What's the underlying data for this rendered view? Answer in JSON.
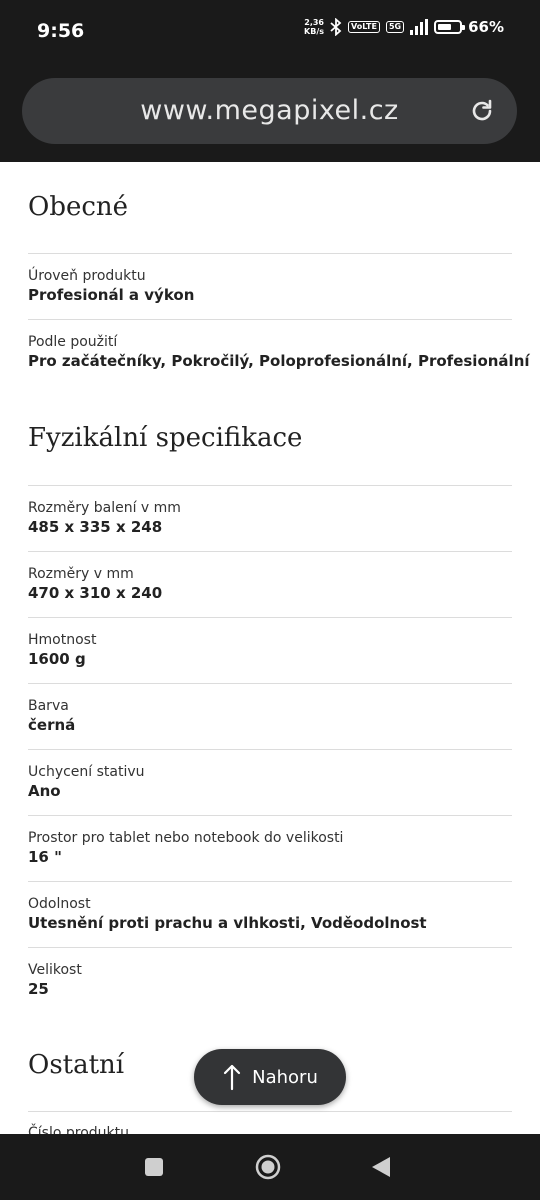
{
  "status": {
    "time": "9:56",
    "netspeed_value": "2,36",
    "netspeed_unit": "KB/s",
    "volte": "VoLTE",
    "network": "5G",
    "battery": "66%",
    "battery_level": 0.66
  },
  "browser": {
    "url": "www.megapixel.cz"
  },
  "sections": [
    {
      "title": "Obecné",
      "rows": [
        {
          "label": "Úroveň produktu",
          "value": "Profesionál a výkon"
        },
        {
          "label": "Podle použití",
          "value": "Pro začátečníky, Pokročilý, Poloprofesionální, Profesionální"
        }
      ]
    },
    {
      "title": "Fyzikální specifikace",
      "rows": [
        {
          "label": "Rozměry balení v mm",
          "value": "485 x 335 x 248"
        },
        {
          "label": "Rozměry v mm",
          "value": "470 x 310 x 240"
        },
        {
          "label": "Hmotnost",
          "value": "1600 g"
        },
        {
          "label": "Barva",
          "value": "černá"
        },
        {
          "label": "Uchycení stativu",
          "value": "Ano"
        },
        {
          "label": "Prostor pro tablet nebo notebook do velikosti",
          "value": "16 \""
        },
        {
          "label": "Odolnost",
          "value": "Utesnění proti prachu a vlhkosti, Voděodolnost"
        },
        {
          "label": "Velikost",
          "value": "25"
        }
      ]
    },
    {
      "title": "Ostatní",
      "rows": [
        {
          "label": "Číslo produktu",
          "value": ""
        }
      ]
    }
  ],
  "fab": {
    "label": "Nahoru"
  }
}
